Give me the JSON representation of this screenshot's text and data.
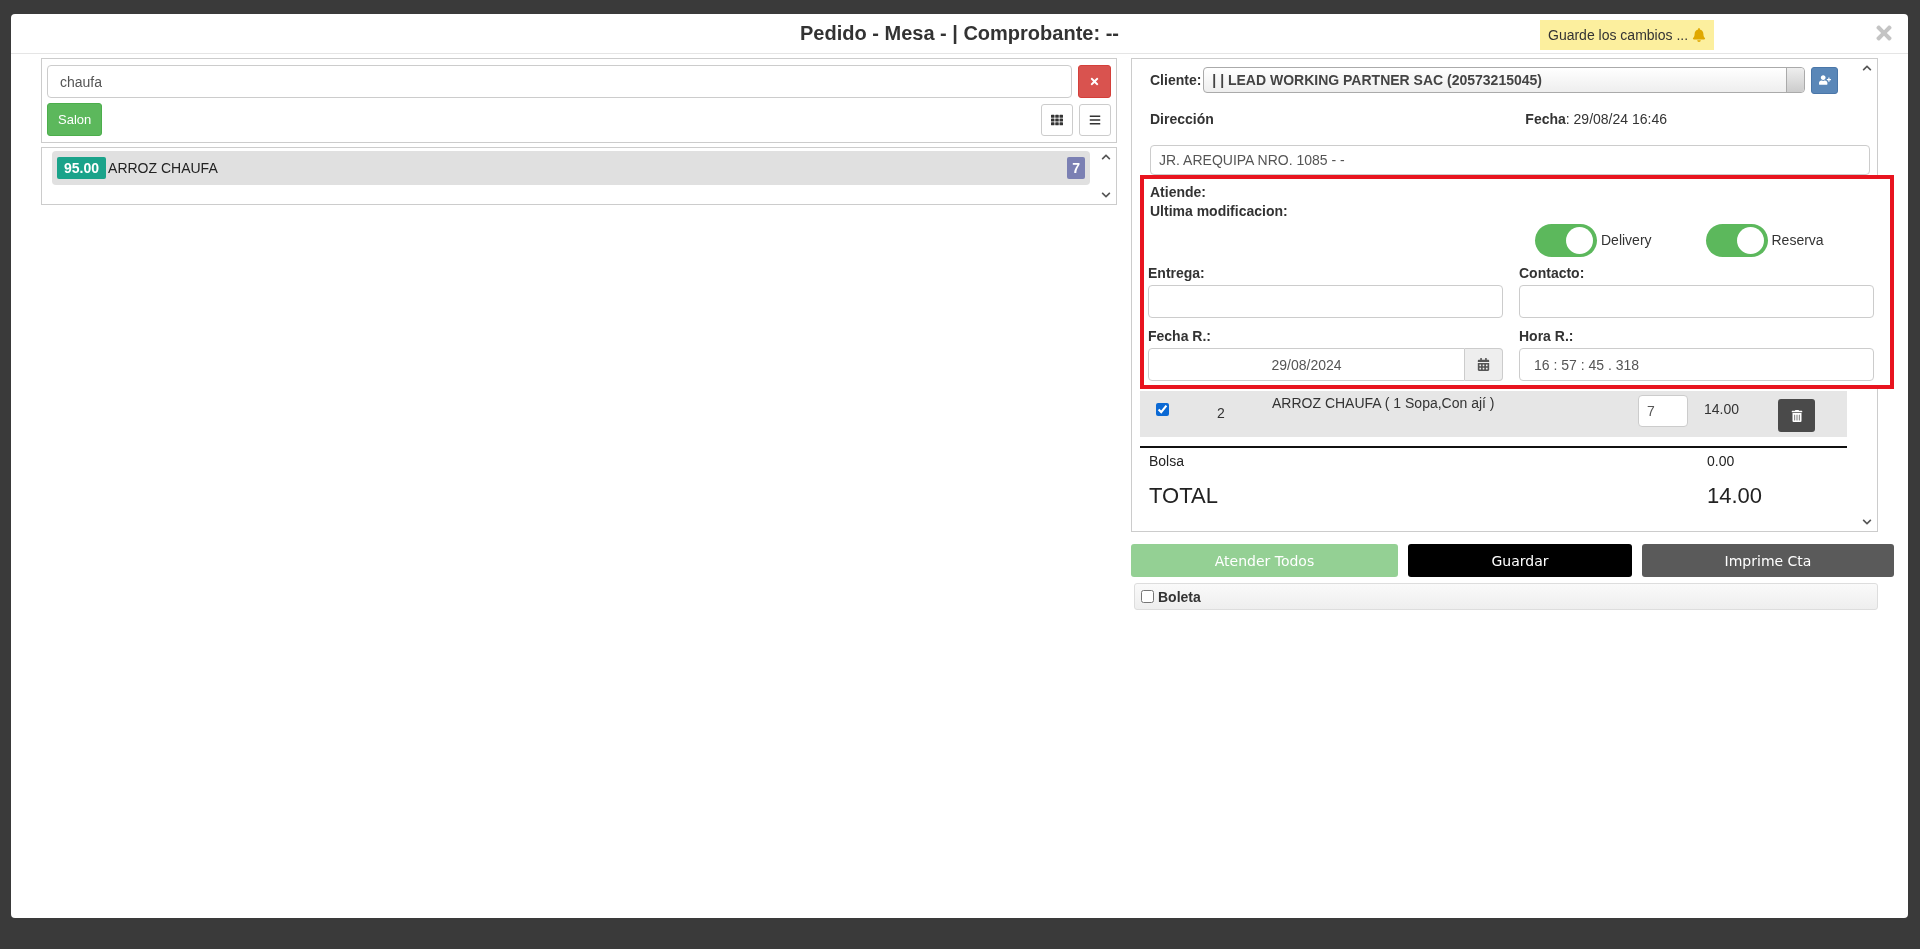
{
  "modal": {
    "title": "Pedido - Mesa - | Comprobante: --",
    "notice": "Guarde los cambios ..."
  },
  "search": {
    "value": "chaufa"
  },
  "filters": [
    {
      "label": "Salon",
      "selected": true
    }
  ],
  "products": [
    {
      "price": "95.00",
      "name": "ARROZ CHAUFA",
      "count": "7"
    }
  ],
  "client": {
    "label": "Cliente:",
    "value": "| | LEAD WORKING PARTNER SAC (20573215045)"
  },
  "address": {
    "label": "Dirección",
    "value": "JR. AREQUIPA NRO. 1085 - -"
  },
  "date": {
    "text": "**Fecha**: 29/08/24 16:46"
  },
  "info": [
    "Atiende:",
    "Ultima modificacion:"
  ],
  "toggles": [
    {
      "label": "Delivery",
      "on": true
    },
    {
      "label": "Reserva",
      "on": true
    }
  ],
  "fields": [
    {
      "label": "Entrega:",
      "kind": "text"
    },
    {
      "label": "Contacto:",
      "kind": "text"
    },
    {
      "label": "Fecha R.:",
      "kind": "date",
      "value": "29/08/2024"
    },
    {
      "label": "Hora R.:",
      "kind": "text",
      "value": "16 : 57 : 45 . 318"
    }
  ],
  "order_lines": [
    {
      "checked": true,
      "number": "2",
      "name": "ARROZ CHAUFA ( 1 Sopa,Con ají )",
      "quantity": "7",
      "amount": "14.00"
    }
  ],
  "totals": [
    {
      "kind": "minor",
      "label": "Bolsa",
      "value": "0.00"
    },
    {
      "kind": "grand",
      "label": "TOTAL",
      "value": "14.00"
    }
  ],
  "actions": [
    {
      "kind": "success",
      "label": "Atender Todos",
      "disabled": true
    },
    {
      "kind": "dark",
      "label": "Guardar",
      "disabled": false
    },
    {
      "kind": "secondary",
      "label": "Imprime Cta",
      "disabled": false
    }
  ],
  "boleta": {
    "label": "Boleta",
    "checked": false
  }
}
